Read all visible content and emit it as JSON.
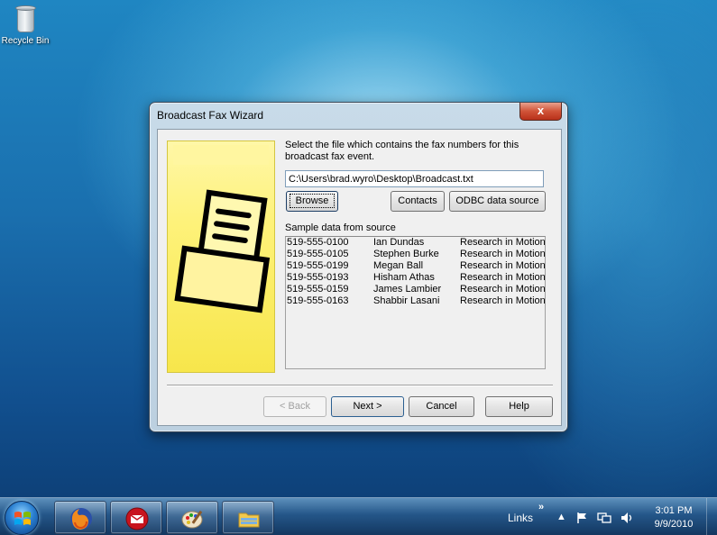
{
  "desktop": {
    "icons": [
      {
        "label": "Recycle Bin",
        "icon": "recycle-bin-icon"
      }
    ]
  },
  "window": {
    "title": "Broadcast Fax Wizard",
    "close_label": "x",
    "instruction": "Select the file which contains the fax numbers for this broadcast fax event.",
    "file_path": "C:\\Users\\brad.wyro\\Desktop\\Broadcast.txt",
    "buttons": {
      "browse": "Browse",
      "contacts": "Contacts",
      "odbc": "ODBC data source",
      "back": "< Back",
      "next": "Next >",
      "cancel": "Cancel",
      "help": "Help"
    },
    "sample_label": "Sample data from source",
    "sample_rows": [
      [
        "519-555-0100",
        "Ian Dundas",
        "Research in Motion,"
      ],
      [
        "519-555-0105",
        "Stephen Burke",
        "Research in Motion,"
      ],
      [
        "519-555-0199",
        "Megan Ball",
        "Research in Motion,"
      ],
      [
        "519-555-0193",
        "Hisham Athas",
        "Research in Motion,"
      ],
      [
        "519-555-0159",
        "James Lambier",
        "Research in Motion,"
      ],
      [
        "519-555-0163",
        "Shabbir Lasani",
        "Research in Motion,"
      ]
    ],
    "side_image_icon": "fax-document-icon"
  },
  "taskbar": {
    "pinned": [
      {
        "icon": "firefox-icon"
      },
      {
        "icon": "fax-app-icon"
      },
      {
        "icon": "paint-icon"
      },
      {
        "icon": "file-explorer-icon"
      }
    ],
    "links_label": "Links",
    "chevron": "»",
    "tray_icons": [
      "show-hidden-icon",
      "action-center-flag-icon",
      "network-icon",
      "volume-icon"
    ],
    "time": "3:01 PM",
    "date": "9/9/2010"
  },
  "colors": {
    "accent_yellow": "#fef27a",
    "close_red": "#d05438",
    "window_frame": "#c8dbe9"
  }
}
